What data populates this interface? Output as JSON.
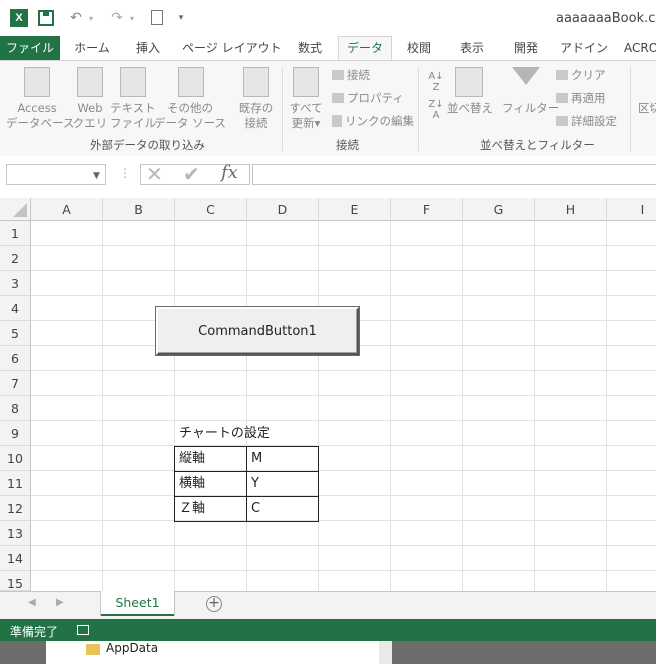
{
  "window": {
    "title": "aaaaaaaBook.c m",
    "app_icon": "X"
  },
  "quick_access": {
    "undo_icon": "undo-icon",
    "redo_icon": "redo-icon",
    "new_icon": "new-document-icon"
  },
  "ribbon_tabs": [
    "ファイル",
    "ホーム",
    "挿入",
    "ページ レイアウト",
    "数式",
    "データ",
    "校閲",
    "表示",
    "開発",
    "アドイン",
    "ACRO"
  ],
  "active_tab": "データ",
  "ribbon": {
    "external_data": {
      "access_line1": "Access",
      "access_line2": "データベース",
      "web_line1": "Web",
      "web_line2": "クエリ",
      "text_line1": "テキスト",
      "text_line2": "ファイル",
      "other_line1": "その他の",
      "other_line2": "データ ソース",
      "existing_line1": "既存の",
      "existing_line2": "接続",
      "group_label": "外部データの取り込み"
    },
    "connections": {
      "refresh_line1": "すべて",
      "refresh_line2": "更新",
      "connections": "接続",
      "properties": "プロパティ",
      "edit_links": "リンクの編集",
      "group_label": "接続"
    },
    "sort_filter": {
      "sort": "並べ替え",
      "filter": "フィルター",
      "clear": "クリア",
      "reapply": "再適用",
      "advanced": "詳細設定",
      "group_label": "並べ替えとフィルター"
    },
    "partial": "区切"
  },
  "formula_bar": {
    "name_box": "",
    "formula": "",
    "fx": "fx"
  },
  "columns": [
    "A",
    "B",
    "C",
    "D",
    "E",
    "F",
    "G",
    "H",
    "I"
  ],
  "rows": [
    "1",
    "2",
    "3",
    "4",
    "5",
    "6",
    "7",
    "8",
    "9",
    "10",
    "11",
    "12",
    "13",
    "14",
    "15"
  ],
  "command_button": "CommandButton1",
  "cells": {
    "C9": "チャートの設定",
    "C10": "縦軸",
    "D10": "M",
    "C11": "横軸",
    "D11": "Y",
    "C12": "Ｚ軸",
    "D12": "C"
  },
  "sheet_tab": "Sheet1",
  "status": "準備完了",
  "background_window": {
    "folder": "AppData"
  }
}
